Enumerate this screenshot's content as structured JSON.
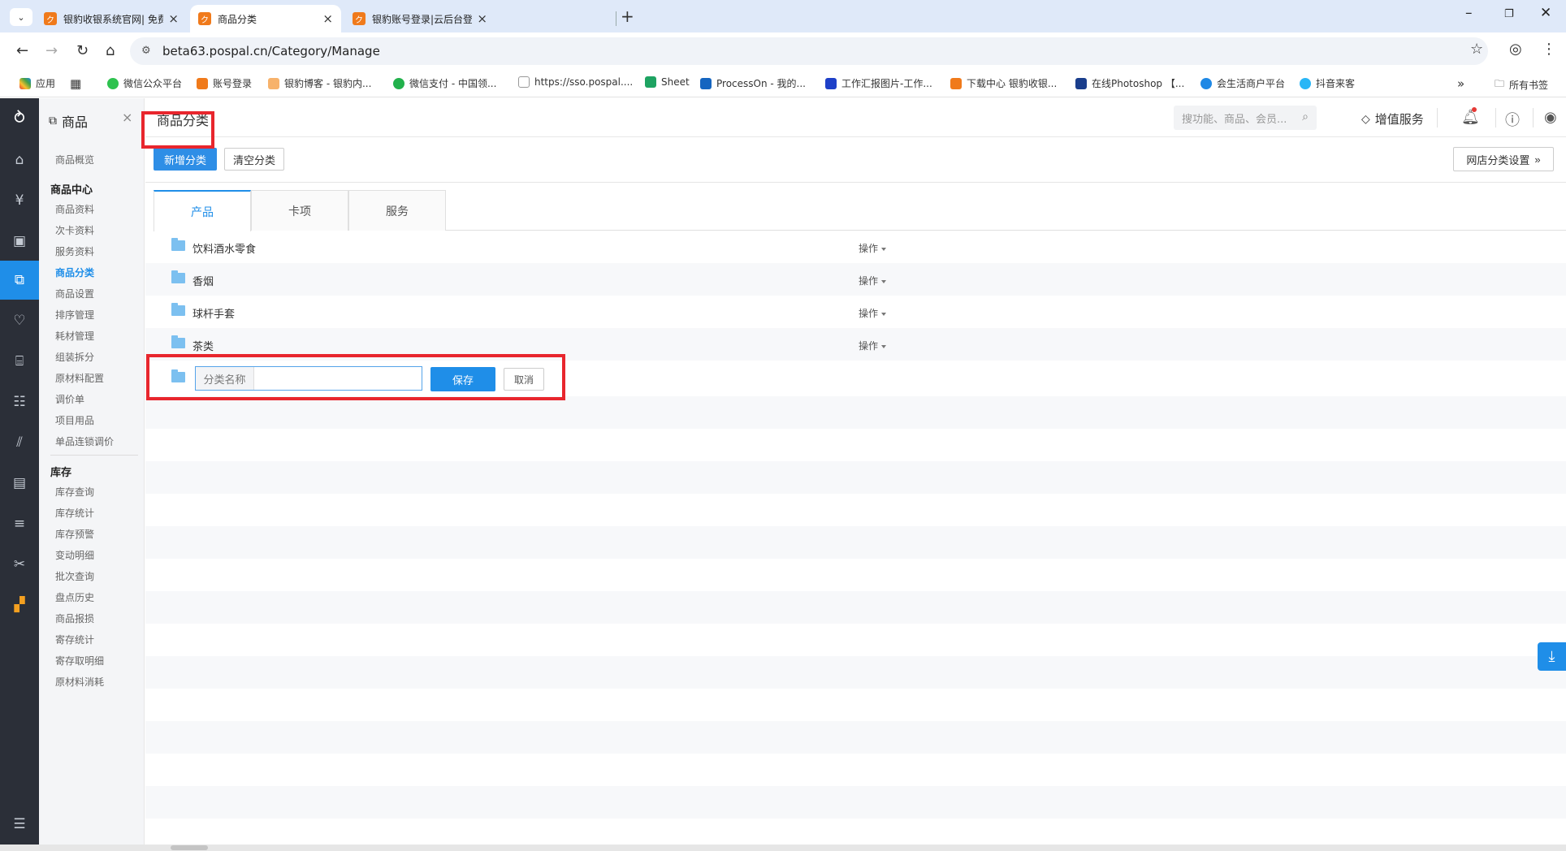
{
  "browser": {
    "tabs": [
      {
        "title": "银豹收银系统官网| 免费POS收",
        "active": false
      },
      {
        "title": "商品分类",
        "active": true
      },
      {
        "title": "银豹账号登录|云后台登录",
        "active": false
      }
    ],
    "url": "beta63.pospal.cn/Category/Manage",
    "bookmarks": [
      {
        "label": "应用",
        "icon": "apps-grid-icon"
      },
      {
        "label": "微信公众平台",
        "icon": "wechat-icon"
      },
      {
        "label": "账号登录",
        "icon": "pospal-icon"
      },
      {
        "label": "银豹博客 - 银豹内...",
        "icon": "pospal-icon"
      },
      {
        "label": "微信支付 - 中国领...",
        "icon": "wechat-pay-icon"
      },
      {
        "label": "https://sso.pospal....",
        "icon": "doc-icon"
      },
      {
        "label": "Sheet",
        "icon": "sheet-icon"
      },
      {
        "label": "ProcessOn - 我的...",
        "icon": "processon-icon"
      },
      {
        "label": "工作汇报图片-工作...",
        "icon": "report-icon"
      },
      {
        "label": "下载中心 银豹收银...",
        "icon": "pospal-icon"
      },
      {
        "label": "在线Photoshop 【...",
        "icon": "photoshop-icon"
      },
      {
        "label": "会生活商户平台",
        "icon": "merchant-icon"
      },
      {
        "label": "抖音来客",
        "icon": "douyin-icon"
      }
    ],
    "all_bookmarks": "所有书签"
  },
  "sidebar": {
    "header": "商品",
    "items": [
      {
        "label": "商品概览",
        "type": "item"
      },
      {
        "label": "商品中心",
        "type": "group"
      },
      {
        "label": "商品资料",
        "type": "item"
      },
      {
        "label": "次卡资料",
        "type": "item"
      },
      {
        "label": "服务资料",
        "type": "item"
      },
      {
        "label": "商品分类",
        "type": "item",
        "active": true
      },
      {
        "label": "商品设置",
        "type": "item"
      },
      {
        "label": "排序管理",
        "type": "item"
      },
      {
        "label": "耗材管理",
        "type": "item"
      },
      {
        "label": "组装拆分",
        "type": "item"
      },
      {
        "label": "原材料配置",
        "type": "item"
      },
      {
        "label": "调价单",
        "type": "item"
      },
      {
        "label": "项目用品",
        "type": "item"
      },
      {
        "label": "单品连锁调价",
        "type": "item"
      },
      {
        "label": "库存",
        "type": "group"
      },
      {
        "label": "库存查询",
        "type": "item"
      },
      {
        "label": "库存统计",
        "type": "item"
      },
      {
        "label": "库存预警",
        "type": "item"
      },
      {
        "label": "变动明细",
        "type": "item"
      },
      {
        "label": "批次查询",
        "type": "item"
      },
      {
        "label": "盘点历史",
        "type": "item"
      },
      {
        "label": "商品报损",
        "type": "item"
      },
      {
        "label": "寄存统计",
        "type": "item"
      },
      {
        "label": "寄存取明细",
        "type": "item"
      },
      {
        "label": "原材料消耗",
        "type": "item"
      }
    ]
  },
  "header": {
    "title": "商品分类",
    "search_placeholder": "搜功能、商品、会员...",
    "value_service": "增值服务"
  },
  "toolbar": {
    "add_label": "新增分类",
    "clear_label": "清空分类",
    "shop_label": "网店分类设置"
  },
  "tabs": [
    {
      "label": "产品",
      "active": true
    },
    {
      "label": "卡项",
      "active": false
    },
    {
      "label": "服务",
      "active": false
    }
  ],
  "categories": [
    {
      "name": "饮料酒水零食",
      "op": "操作"
    },
    {
      "name": "香烟",
      "op": "操作"
    },
    {
      "name": "球杆手套",
      "op": "操作"
    },
    {
      "name": "茶类",
      "op": "操作"
    }
  ],
  "new_category": {
    "label": "分类名称",
    "value": "",
    "save": "保存",
    "cancel": "取消"
  },
  "colors": {
    "accent": "#1f8ee8",
    "highlight_box": "#e8262d",
    "rail_bg": "#2b2f38"
  }
}
